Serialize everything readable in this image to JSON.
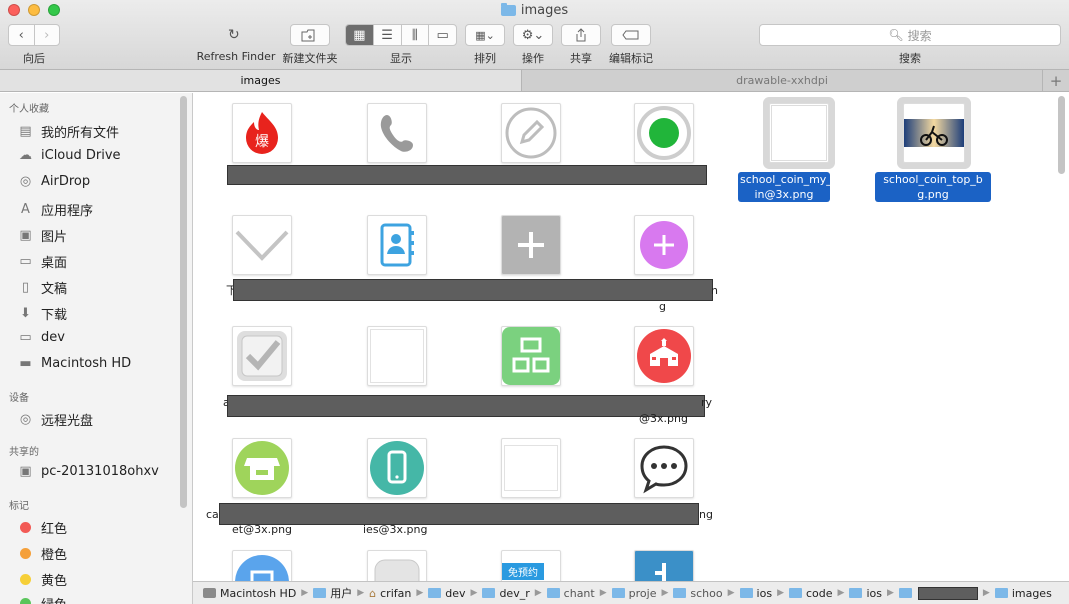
{
  "window": {
    "title": "images"
  },
  "toolbar": {
    "back_label": "向后",
    "refresh_label": "Refresh Finder",
    "newfolder_label": "新建文件夹",
    "view_label": "显示",
    "arrange_label": "排列",
    "action_label": "操作",
    "share_label": "共享",
    "tags_label": "编辑标记",
    "search_label": "搜索",
    "search_placeholder": "搜索"
  },
  "tabs": [
    {
      "label": "images",
      "active": true
    },
    {
      "label": "drawable-xxhdpi",
      "active": false
    }
  ],
  "sidebar": {
    "favorites_header": "个人收藏",
    "favorites": [
      {
        "label": "我的所有文件",
        "icon": "all-files-icon"
      },
      {
        "label": "iCloud Drive",
        "icon": "cloud-icon"
      },
      {
        "label": "AirDrop",
        "icon": "airdrop-icon"
      },
      {
        "label": "应用程序",
        "icon": "applications-icon"
      },
      {
        "label": "图片",
        "icon": "camera-icon"
      },
      {
        "label": "桌面",
        "icon": "desktop-icon"
      },
      {
        "label": "文稿",
        "icon": "document-icon"
      },
      {
        "label": "下载",
        "icon": "download-icon"
      },
      {
        "label": "dev",
        "icon": "folder-icon"
      },
      {
        "label": "Macintosh HD",
        "icon": "disk-icon"
      }
    ],
    "devices_header": "设备",
    "devices": [
      {
        "label": "远程光盘",
        "icon": "disc-icon"
      }
    ],
    "shared_header": "共享的",
    "shared": [
      {
        "label": "pc-20131018ohxv",
        "icon": "computer-icon"
      }
    ],
    "tags_header": "标记",
    "tags": [
      {
        "label": "红色",
        "color": "#f25a55"
      },
      {
        "label": "橙色",
        "color": "#f5a03a"
      },
      {
        "label": "黄色",
        "color": "#f6cf37"
      },
      {
        "label": "绿色",
        "color": "#5ac55b"
      }
    ]
  },
  "files": {
    "selected": [
      {
        "line1": "school_coin_my_co",
        "line2": "in@3x.png"
      },
      {
        "line1": "school_coin_top_b",
        "line2": "g.png"
      }
    ],
    "fragments": {
      "row2_left": "下",
      "row2_right": "n",
      "row2_sub": "g",
      "row3_left": "a",
      "row3_right": "ry",
      "row3_sub": "@3x.png",
      "row4_left": "ca",
      "row4_right": "ng",
      "row4_sub1": "et@3x.png",
      "row4_sub2": "ies@3x.png",
      "tile_text_row5": "免预约"
    },
    "thumbnail_icons": [
      "fire-icon",
      "phone-icon",
      "pencil-circle-icon",
      "green-dot-icon",
      "blank-icon",
      "cyclists-photo-icon",
      "chevron-down-icon",
      "contacts-book-icon",
      "plus-square-icon",
      "plus-circle-icon",
      "checkbox-icon",
      "blank-icon",
      "product-grid-icon",
      "school-icon",
      "store-icon",
      "mobile-icon",
      "blank-icon",
      "chat-bubble-icon"
    ]
  },
  "pathbar": [
    {
      "label": "Macintosh HD",
      "icon": "disk-icon"
    },
    {
      "label": "用户",
      "icon": "folder-icon"
    },
    {
      "label": "crifan",
      "icon": "home-icon"
    },
    {
      "label": "dev",
      "icon": "folder-icon"
    },
    {
      "label": "dev_r",
      "icon": "folder-icon"
    },
    {
      "label": "chant",
      "icon": "folder-icon"
    },
    {
      "label": "proje",
      "icon": "folder-icon"
    },
    {
      "label": "schoo",
      "icon": "folder-icon"
    },
    {
      "label": "ios",
      "icon": "folder-icon"
    },
    {
      "label": "code",
      "icon": "folder-icon"
    },
    {
      "label": "ios",
      "icon": "folder-icon"
    },
    {
      "label": "",
      "icon": "folder-icon"
    },
    {
      "label": "images",
      "icon": "folder-icon"
    }
  ]
}
